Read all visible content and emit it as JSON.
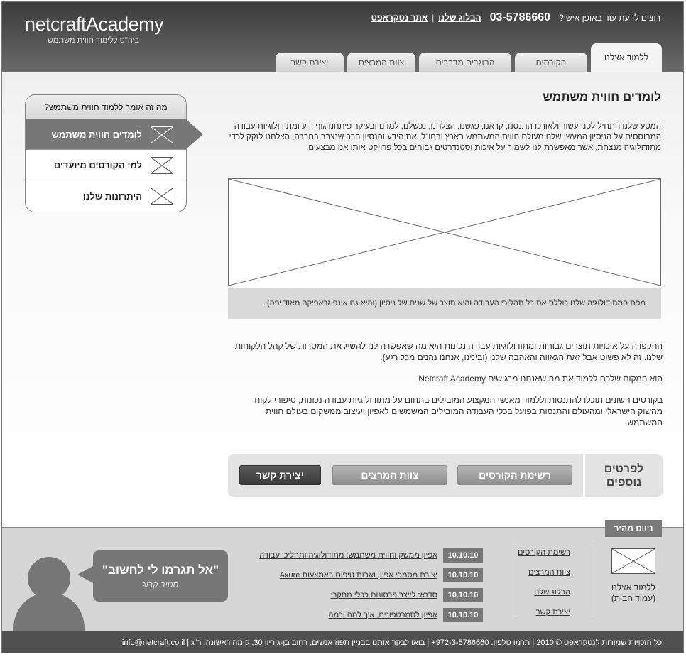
{
  "header": {
    "logo_part1": "netcraft",
    "logo_part2": "Academy",
    "logo_sub": "ביה\"ס ללימוד חווית משתמש",
    "contact_question": "רוצים לדעת עוד באופן אישי?",
    "phone": "03-5786660",
    "blog_link": "הבלוג שלנו",
    "separator": "|",
    "site_link": "אתר נטקראפט"
  },
  "tabs": [
    {
      "label": "ללמוד אצלנו",
      "active": true
    },
    {
      "label": "הקורסים",
      "active": false
    },
    {
      "label": "הבוגרים מדברים",
      "active": false
    },
    {
      "label": "צוות המרצים",
      "active": false
    },
    {
      "label": "יצירת קשר",
      "active": false
    }
  ],
  "sidebox": {
    "title": "מה זה אומר ללמוד חווית משתמש?",
    "items": [
      {
        "label": "לומדים חווית משתמש",
        "active": true
      },
      {
        "label": "למי הקורסים מיועדים",
        "active": false
      },
      {
        "label": "היתרונות שלנו",
        "active": false
      }
    ]
  },
  "article": {
    "title": "לומדים חווית משתמש",
    "intro": "המסע שלנו התחיל לפני עשור ולאורכו התנסנו, קראנו, פגשנו, הצלחנו, נכשלנו, למדנו ובעיקר פיתחנו גוף ידע ומתודולוגיות עבודה המבוססים על הניסיון המעשי שלנו מעולם חווית המשתמש בארץ ובחו\"ל. את הידע והנסיון הרב שנצבר בחברה, הצלחנו לזקק לכדי מתודולוגיה מנצחת, אשר מאפשרת לנו לשמור על איכות וסטנדרטים גבוהים בכל פרויקט אותו אנו מבצעים.",
    "caption": "מפת המתודולוגיה שלנו כוללת את כל תהליכי העבודה והיא תוצר של שנים של ניסיון (והיא גם אינפוגראפיקה מאוד יפה).",
    "para1": "ההקפדה על איכויות תוצרים גבוהות ומתודולוגיות עבודה נכונות היא מה שאפשרה לנו להשיג את המטרות של קהל הלקוחות שלנו. זה לא פשוט אבל זאת הגאווה והאהבה שלנו (ובינינו, אנחנו נהנים מכל רגע).",
    "para2": "הוא המקום שלכם ללמוד את מה שאנחנו מרגישים Netcraft Academy",
    "para3": "בקורסים השונים תוכלו להתנסות וללמוד מאנשי המקצוע המובילים בתחום על מתודולוגיות עבודה נכונות, סיפורי לקוח מהשוק הישראלי ומהעולם והתנסות בפועל בכלי העבודה המובילים המשמשים לאפיון ועיצוב ממשקים בעולם חווית המשתמש."
  },
  "cta": {
    "label_line1": "לפרטים",
    "label_line2": "נוספים",
    "courses": "רשימת הקורסים",
    "lecturers": "צוות המרצים",
    "contact": "יצירת קשר"
  },
  "footer": {
    "quick_nav": "ניווט מהיר",
    "home_line1": "ללמוד אצלנו",
    "home_line2": "(עמוד הבית)",
    "links": [
      "רשימת הקורסים",
      "צוות המרצים",
      "הבלוג שלנו",
      "יצירת קשר"
    ],
    "news": [
      {
        "date": "10.10.10",
        "text": "אפיון ממשק וחווית משתמש: מתודולוגיה ותהליכי עבודה"
      },
      {
        "date": "10.10.10",
        "text": "יצירת מסמכי אפיון ואבות טיפוס באמצעות Axure"
      },
      {
        "date": "10.10.10",
        "text": "סדנא: לייצר פרסונות ככלי מחקרי"
      },
      {
        "date": "10.10.10",
        "text": "אפיון לסמרטפונים, איך למה וכמה"
      }
    ],
    "quote": "\"אל תגרמו לי לחשוב\"",
    "quote_author": "סטיב קרוג",
    "bottom_text": "כל הזכויות שמורות לנטקראפט © 2010  |  תרמו טלפון: 972-3-5786660+  |  בואו לבקר אותנו בבניין תפוז אנשים, רחוב בן-גוריון 30, קומה ראשונה, ר\"ג  |  info@netcraft.co.il"
  }
}
